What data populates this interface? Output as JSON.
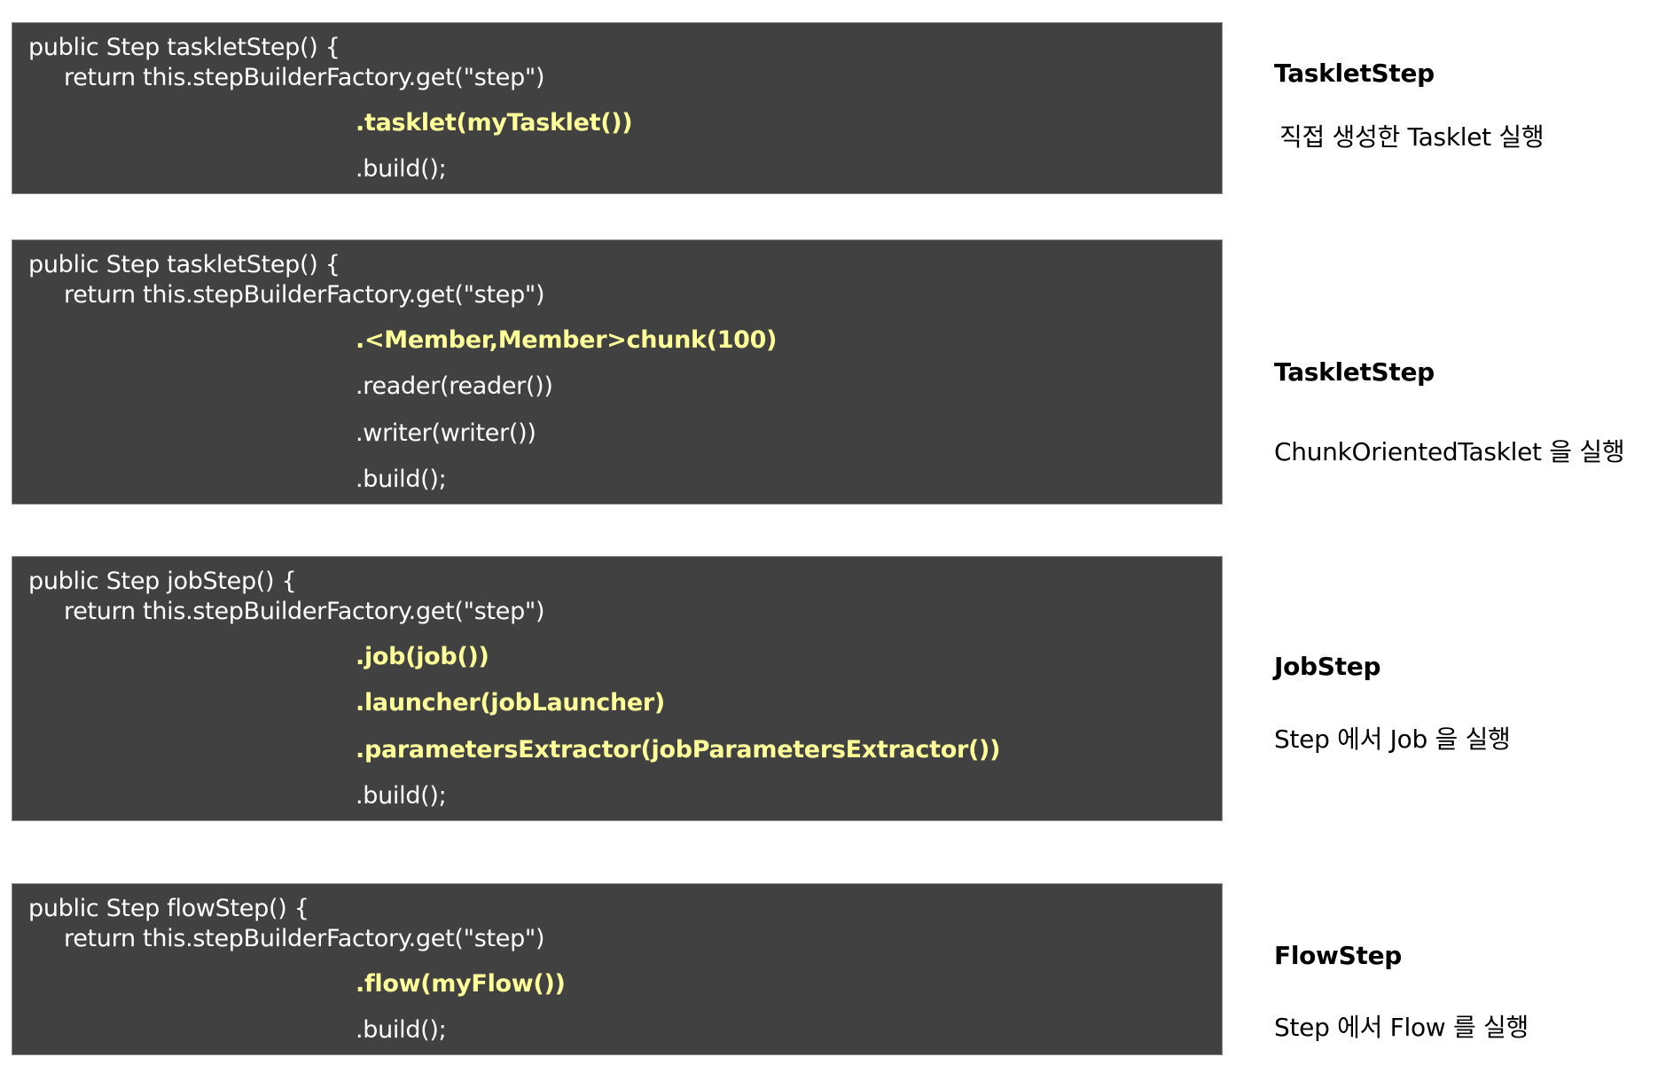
{
  "sections": [
    {
      "code": {
        "signature": "public Step taskletStep() {",
        "return_line": "return this.stepBuilderFactory.get(\"step\")",
        "chain": [
          {
            "text": ".tasklet(myTasklet())",
            "highlight": true
          },
          {
            "text": ".build();",
            "highlight": false
          }
        ]
      },
      "desc": {
        "title": "TaskletStep",
        "text": "직접 생성한 Tasklet 실행"
      }
    },
    {
      "code": {
        "signature": "public Step taskletStep() {",
        "return_line": "return this.stepBuilderFactory.get(\"step\")",
        "chain": [
          {
            "text": ".<Member,Member>chunk(100)",
            "highlight": true
          },
          {
            "text": ".reader(reader())",
            "highlight": false
          },
          {
            "text": ".writer(writer())",
            "highlight": false
          },
          {
            "text": ".build();",
            "highlight": false
          }
        ]
      },
      "desc": {
        "title": "TaskletStep",
        "text": "ChunkOrientedTasklet 을 실행"
      }
    },
    {
      "code": {
        "signature": "public Step jobStep() {",
        "return_line": "return this.stepBuilderFactory.get(\"step\")",
        "chain": [
          {
            "text": ".job(job())",
            "highlight": true
          },
          {
            "text": ".launcher(jobLauncher)",
            "highlight": true
          },
          {
            "text": ".parametersExtractor(jobParametersExtractor())",
            "highlight": true
          },
          {
            "text": ".build();",
            "highlight": false
          }
        ]
      },
      "desc": {
        "title": "JobStep",
        "text": "Step 에서 Job 을 실행"
      }
    },
    {
      "code": {
        "signature": "public Step flowStep() {",
        "return_line": "return this.stepBuilderFactory.get(\"step\")",
        "chain": [
          {
            "text": ".flow(myFlow())",
            "highlight": true
          },
          {
            "text": ".build();",
            "highlight": false
          }
        ]
      },
      "desc": {
        "title": "FlowStep",
        "text": "Step 에서 Flow 를 실행"
      }
    }
  ],
  "colors": {
    "code_background": "#414141",
    "code_text": "#ffffff",
    "highlight_text": "#ffff99"
  }
}
